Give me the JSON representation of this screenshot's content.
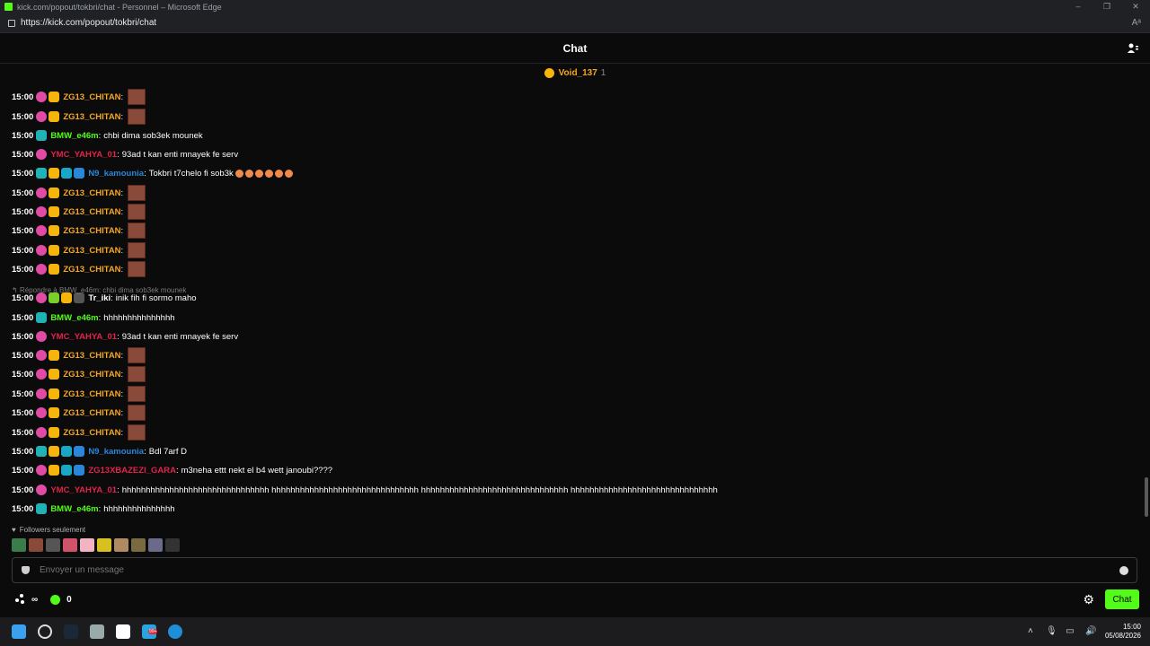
{
  "window": {
    "title": "kick.com/popout/tokbri/chat - Personnel – Microsoft Edge",
    "url": "https://kick.com/popout/tokbri/chat",
    "controls": [
      "–",
      "❐",
      "✕"
    ],
    "read_aloud": "Aᵃ"
  },
  "header": {
    "title": "Chat"
  },
  "pinned": {
    "user": "Void_137",
    "count": "1"
  },
  "colors": {
    "kick_green": "#53fc18",
    "zg13": "#f5a623",
    "bmw": "#53fc18",
    "ymc": "#e0244a",
    "n9": "#2b86d9",
    "trki": "#ffffff",
    "gara": "#e0244a"
  },
  "messages": [
    {
      "time": "15:00",
      "user": "ZG13_CHITAN",
      "text": ""
    },
    {
      "time": "15:00",
      "user": "ZG13_CHITAN",
      "text": ""
    },
    {
      "time": "15:00",
      "user": "BMW_e46m",
      "text": "chbi dima sob3ek mounek"
    },
    {
      "time": "15:00",
      "user": "YMC_YAHYA_01",
      "text": "93ad t kan enti mnayek fe serv"
    },
    {
      "time": "15:00",
      "user": "N9_kamounia",
      "text": "Tokbri t7chelo fi sob3k"
    },
    {
      "time": "15:00",
      "user": "ZG13_CHITAN",
      "text": ""
    },
    {
      "time": "15:00",
      "user": "ZG13_CHITAN",
      "text": ""
    },
    {
      "time": "15:00",
      "user": "ZG13_CHITAN",
      "text": ""
    },
    {
      "time": "15:00",
      "user": "ZG13_CHITAN",
      "text": ""
    },
    {
      "time": "15:00",
      "user": "ZG13_CHITAN",
      "text": ""
    },
    {
      "time": "15:00",
      "user": "Tr_iki",
      "text": "inik fih fi sormo maho"
    },
    {
      "time": "15:00",
      "user": "BMW_e46m",
      "text": "hhhhhhhhhhhhhhh"
    },
    {
      "time": "15:00",
      "user": "YMC_YAHYA_01",
      "text": "93ad t kan enti mnayek fe serv"
    },
    {
      "time": "15:00",
      "user": "ZG13_CHITAN",
      "text": ""
    },
    {
      "time": "15:00",
      "user": "ZG13_CHITAN",
      "text": ""
    },
    {
      "time": "15:00",
      "user": "ZG13_CHITAN",
      "text": ""
    },
    {
      "time": "15:00",
      "user": "ZG13_CHITAN",
      "text": ""
    },
    {
      "time": "15:00",
      "user": "ZG13_CHITAN",
      "text": ""
    },
    {
      "time": "15:00",
      "user": "N9_kamounia",
      "text": "Bdl 7arf D"
    },
    {
      "time": "15:00",
      "user": "ZG13XBAZEZI_GARA",
      "text": "m3neha ettt nekt el b4 wett janoubi????"
    },
    {
      "time": "15:00",
      "user": "YMC_YAHYA_01",
      "text": "hhhhhhhhhhhhhhhhhhhhhhhhhhhhhhh hhhhhhhhhhhhhhhhhhhhhhhhhhhhhhh hhhhhhhhhhhhhhhhhhhhhhhhhhhhhhh hhhhhhhhhhhhhhhhhhhhhhhhhhhhhhh"
    },
    {
      "time": "15:00",
      "user": "BMW_e46m",
      "text": "hhhhhhhhhhhhhhh"
    }
  ],
  "reply_note": "Répondre à BMW_e46m: chbi dima sob3ek mounek",
  "followers_only": "Followers seulement",
  "input": {
    "placeholder": "Envoyer un message"
  },
  "bottom": {
    "infinity": "∞",
    "count": "0",
    "send": "Chat"
  },
  "taskbar": {
    "time": "15:00",
    "date": "05/08/2026",
    "badge": "99+"
  }
}
